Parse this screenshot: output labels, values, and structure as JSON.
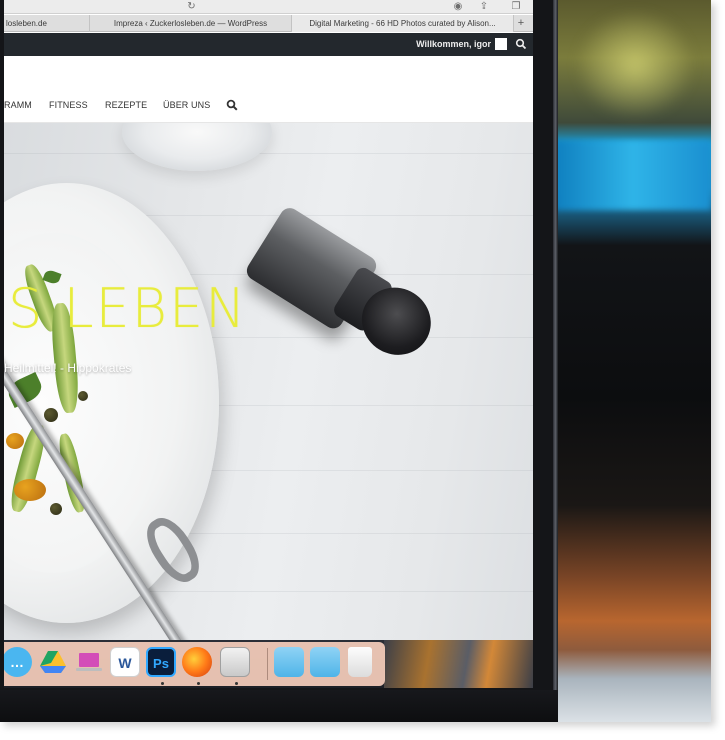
{
  "browser": {
    "tabs": [
      {
        "label": "losleben.de",
        "active": false
      },
      {
        "label": "Impreza ‹ Zuckerlosleben.de — WordPress",
        "active": false
      },
      {
        "label": "Digital Marketing - 66 HD Photos curated by Alison...",
        "active": true
      }
    ],
    "new_tab_label": "+"
  },
  "adminbar": {
    "welcome_text": "Willkommen, igor"
  },
  "nav": {
    "items": [
      "RAMM",
      "FITNESS",
      "REZEPTE",
      "ÜBER UNS"
    ]
  },
  "hero": {
    "title": "S LEBEN",
    "tagline": "Heilmittel! - Hippokrates",
    "title_color": "#e8ec3c"
  },
  "dock": {
    "icons": [
      "messages-icon",
      "google-drive-icon",
      "macbook-icon",
      "word-icon",
      "photoshop-icon",
      "firefox-icon",
      "preview-icon",
      "folder-icon",
      "downloads-folder-icon",
      "trash-icon"
    ],
    "labels": {
      "word": "W",
      "photoshop": "Ps"
    }
  },
  "colors": {
    "adminbar_bg": "#23282d",
    "dock_bg": "#f6cebc"
  }
}
